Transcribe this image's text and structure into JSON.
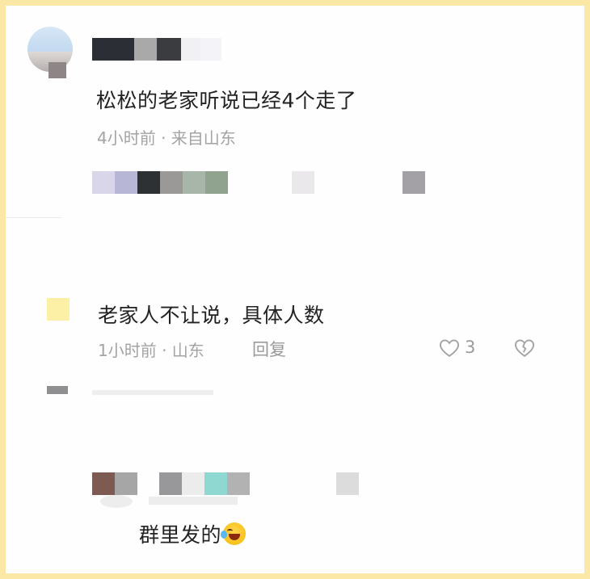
{
  "thread": {
    "comment1": {
      "text": "松松的老家听说已经4个走了",
      "meta": "4小时前 · 来自山东"
    },
    "reply1": {
      "text": "老家人不让说，具体人数",
      "meta": "1小时前 · 山东",
      "reply_label": "回复",
      "like_count": "3"
    },
    "reply2": {
      "text": "群里发的"
    }
  },
  "icons": {
    "like": "heart-outline-icon",
    "dislike": "broken-heart-icon",
    "emoji": "laughing-tears-emoji"
  },
  "colors": {
    "frame_border": "#fbe7a6",
    "primary_text": "#222222",
    "secondary_text": "#a3a3a3"
  }
}
